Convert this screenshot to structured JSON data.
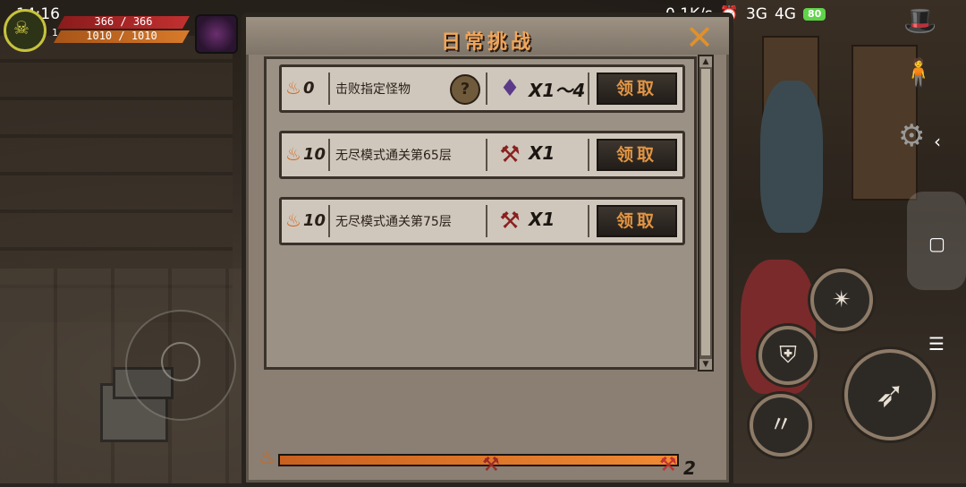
{
  "status_bar": {
    "time": "14:16",
    "network_speed": "0.1K/s",
    "signal_3g": "3G",
    "signal_4g": "4G",
    "battery": "80"
  },
  "player": {
    "level": "1",
    "hp": "366 / 366",
    "mp": "1010 / 1010"
  },
  "dialog": {
    "title": "日常挑战",
    "close_symbol": "✕"
  },
  "tasks": [
    {
      "cost": "0",
      "description": "击败指定怪物",
      "has_hint": true,
      "reward_icon": "purple-crystal-icon",
      "reward_qty": "X1～4",
      "claim_label": "领取"
    },
    {
      "cost": "10",
      "description": "无尽模式通关第65层",
      "has_hint": false,
      "reward_icon": "axe-icon",
      "reward_qty": "X1",
      "claim_label": "领取"
    },
    {
      "cost": "10",
      "description": "无尽模式通关第75层",
      "has_hint": false,
      "reward_icon": "axe-icon",
      "reward_qty": "X1",
      "claim_label": "领取"
    }
  ],
  "progress": {
    "value": "2",
    "fill_fraction": 1.0
  },
  "colors": {
    "accent_orange": "#e29543",
    "title_orange": "#f0a65a",
    "panel_bg": "#9b9184"
  }
}
